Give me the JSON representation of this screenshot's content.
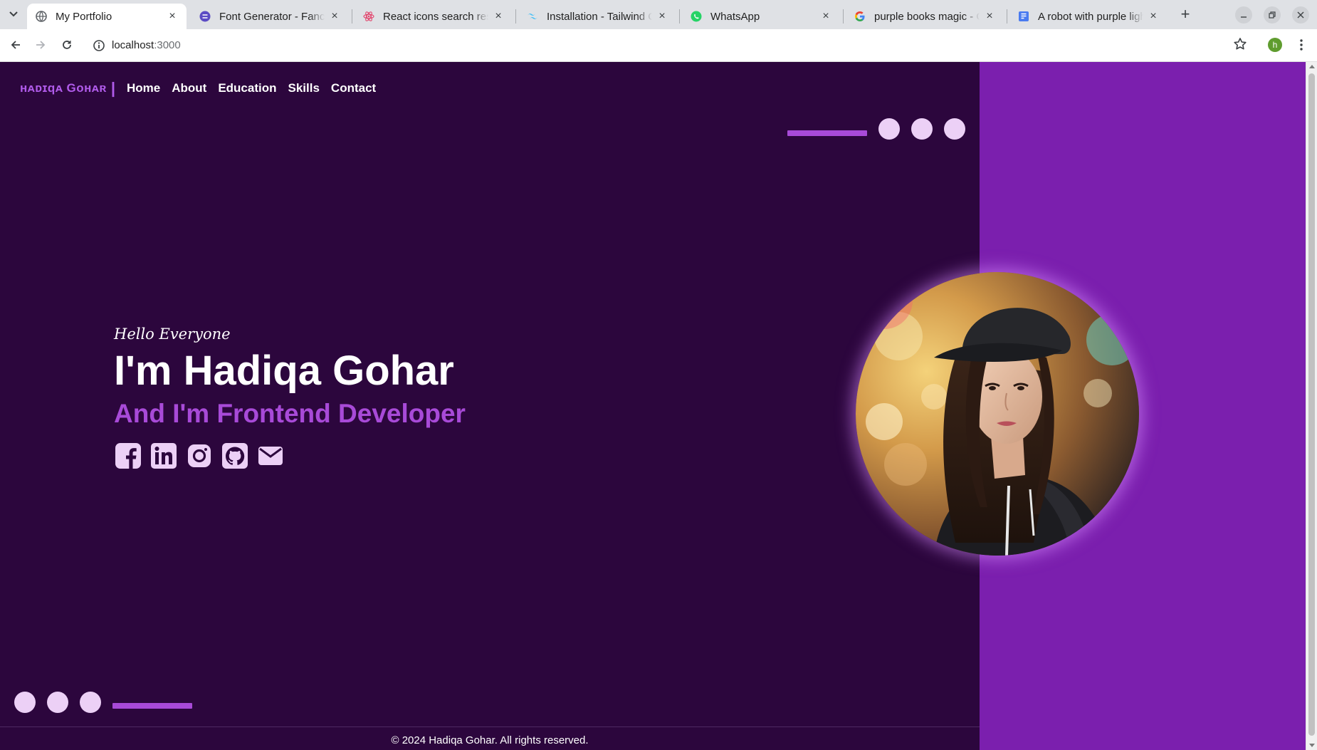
{
  "browser": {
    "tabs": [
      {
        "title": "My Portfolio",
        "icon": "globe-icon",
        "active": true
      },
      {
        "title": "Font Generator - Fancy",
        "icon": "font-generator-icon",
        "active": false
      },
      {
        "title": "React icons search resu",
        "icon": "react-icon",
        "active": false
      },
      {
        "title": "Installation - Tailwind C",
        "icon": "tailwind-icon",
        "active": false
      },
      {
        "title": "WhatsApp",
        "icon": "whatsapp-icon",
        "active": false
      },
      {
        "title": "purple books magic - Go",
        "icon": "google-icon",
        "active": false
      },
      {
        "title": "A robot with purple ligh",
        "icon": "document-icon",
        "active": false
      }
    ],
    "url_host": "localhost",
    "url_port": ":3000",
    "profile_initial": "h"
  },
  "site": {
    "logo": "ʜᴀᴅɪqᴀ Gᴏʜᴀʀ",
    "logo_divider": "|",
    "nav": [
      {
        "label": "Home"
      },
      {
        "label": "About"
      },
      {
        "label": "Education"
      },
      {
        "label": "Skills"
      },
      {
        "label": "Contact"
      }
    ],
    "hero": {
      "greeting": "Hello Everyone",
      "name": "I'm Hadiqa Gohar",
      "role": "And I'm Frontend Developer"
    },
    "socials": [
      {
        "icon": "facebook-icon"
      },
      {
        "icon": "linkedin-icon"
      },
      {
        "icon": "instagram-icon"
      },
      {
        "icon": "github-icon"
      },
      {
        "icon": "mail-icon"
      }
    ],
    "footer": "© 2024 Hadiqa Gohar. All rights reserved."
  },
  "colors": {
    "page_bg": "#2c063d",
    "accent_panel": "#7b1fae",
    "accent_text": "#a84ad8",
    "dot": "#ecd0f6"
  }
}
